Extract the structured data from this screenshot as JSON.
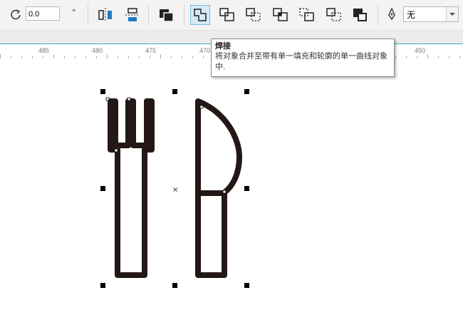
{
  "toolbar": {
    "rotation_value": "0.0",
    "degree_symbol": "°",
    "outline_value": "无",
    "icons": [
      "rotate-icon",
      "mirror-horizontal-icon",
      "mirror-vertical-icon",
      "group-icon",
      "weld-icon",
      "trim-icon",
      "intersect-icon",
      "simplify-icon",
      "front-minus-back-icon",
      "back-minus-front-icon",
      "boundary-icon",
      "pen-outline-icon"
    ],
    "active_tool": "weld-icon"
  },
  "tooltip": {
    "title": "焊接",
    "body": "将对象合并至带有单一填充和轮廓的单一曲线对象中."
  },
  "ruler": {
    "labels": [
      "485",
      "480",
      "475",
      "470",
      "450"
    ],
    "accent_color": "#3aa8d8"
  },
  "canvas": {
    "objects": [
      "fork-icon",
      "knife-icon"
    ],
    "center_marker": "×",
    "stroke_color": "#231815"
  }
}
